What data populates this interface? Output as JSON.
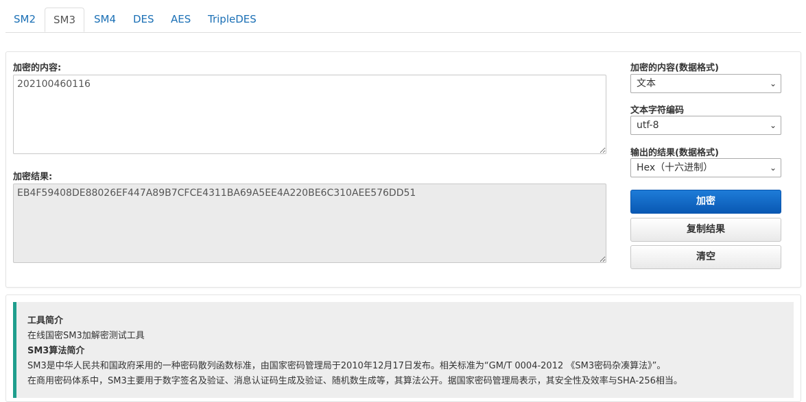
{
  "tabs": [
    "SM2",
    "SM3",
    "SM4",
    "DES",
    "AES",
    "TripleDES"
  ],
  "active_tab": "SM3",
  "input": {
    "label": "加密的内容:",
    "value": "202100460116"
  },
  "output": {
    "label": "加密结果:",
    "value": "EB4F59408DE88026EF447A89B7CFCE4311BA69A5EE4A220BE6C310AEE576DD51"
  },
  "options": {
    "input_format": {
      "label": "加密的内容(数据格式)",
      "value": "文本"
    },
    "encoding": {
      "label": "文本字符编码",
      "value": "utf-8"
    },
    "output_format": {
      "label": "输出的结果(数据格式)",
      "value": "Hex（十六进制）"
    }
  },
  "buttons": {
    "encrypt": "加密",
    "copy": "复制结果",
    "clear": "清空"
  },
  "info": {
    "tool_title": "工具简介",
    "tool_desc": "在线国密SM3加解密测试工具",
    "algo_title": "SM3算法简介",
    "algo_desc_1": "SM3是中华人民共和国政府采用的一种密码散列函数标准，由国家密码管理局于2010年12月17日发布。相关标准为“GM/T 0004-2012 《SM3密码杂凑算法》”。",
    "algo_desc_2": "在商用密码体系中，SM3主要用于数字签名及验证、消息认证码生成及验证、随机数生成等，其算法公开。据国家密码管理局表示，其安全性及效率与SHA-256相当。"
  },
  "colors": {
    "link": "#1a6fb5",
    "primary": "#0a67c9",
    "accent_bar": "#1f9e8d"
  }
}
